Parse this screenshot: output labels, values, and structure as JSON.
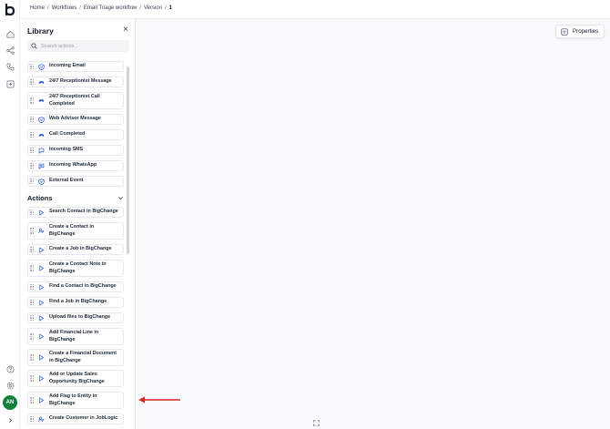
{
  "breadcrumb": {
    "items": [
      "Home",
      "Workflows",
      "Email Triage workflow",
      "Version"
    ],
    "current": "1"
  },
  "library": {
    "title": "Library",
    "search_placeholder": "Search actions...",
    "triggers": [
      {
        "label": "Incoming Email",
        "icon": "shield-check-icon"
      },
      {
        "label": "24/7 Receptionist Message",
        "icon": "phone-icon"
      },
      {
        "label": "24/7 Receptionist Call Completed",
        "icon": "phone-icon"
      },
      {
        "label": "Web Advisor Message",
        "icon": "shield-check-icon"
      },
      {
        "label": "Call Completed",
        "icon": "phone-icon"
      },
      {
        "label": "Incoming SMS",
        "icon": "message-icon"
      },
      {
        "label": "Incoming WhatsApp",
        "icon": "message-lines-icon"
      },
      {
        "label": "External Event",
        "icon": "shield-check-icon"
      }
    ],
    "actions_title": "Actions",
    "actions": [
      {
        "label": "Search Contact in BigChange",
        "icon": "play-icon"
      },
      {
        "label": "Create a Contact in BigChange",
        "icon": "users-icon"
      },
      {
        "label": "Create a Job in BigChange",
        "icon": "play-icon"
      },
      {
        "label": "Create a Contact Note in BigChange",
        "icon": "play-icon"
      },
      {
        "label": "Find a Contact in BigChange",
        "icon": "play-icon"
      },
      {
        "label": "Find a Job in BigChange",
        "icon": "play-icon"
      },
      {
        "label": "Upload files to BigChange",
        "icon": "play-icon"
      },
      {
        "label": "Add Financial Line in BigChange",
        "icon": "play-icon"
      },
      {
        "label": "Create a Financial Document in BigChange",
        "icon": "play-icon"
      },
      {
        "label": "Add or Update Sales Opportunity BigChange",
        "icon": "play-icon"
      },
      {
        "label": "Add Flag to Entity in BigChange",
        "icon": "play-icon"
      },
      {
        "label": "Create Customer in JobLogic",
        "icon": "users-icon"
      }
    ]
  },
  "toolbar": {
    "properties_label": "Properties"
  },
  "user": {
    "initials": "AN"
  },
  "colors": {
    "accent": "#1d4ed8",
    "avatar": "#15803d",
    "annotation_arrow": "#dc2626"
  }
}
